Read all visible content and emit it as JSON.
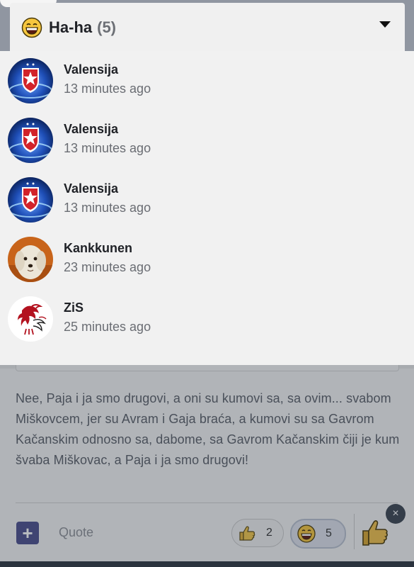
{
  "popup": {
    "reaction_name": "Ha-ha",
    "reaction_count": "(5)",
    "users": [
      {
        "name": "Valensija",
        "time": "13 minutes ago",
        "avatar": "crvena-zvezda-logo"
      },
      {
        "name": "Valensija",
        "time": "13 minutes ago",
        "avatar": "crvena-zvezda-logo"
      },
      {
        "name": "Valensija",
        "time": "13 minutes ago",
        "avatar": "crvena-zvezda-logo"
      },
      {
        "name": "Kankkunen",
        "time": "23 minutes ago",
        "avatar": "white-dog-photo"
      },
      {
        "name": "ZiS",
        "time": "25 minutes ago",
        "avatar": "liverbird-logo"
      }
    ]
  },
  "post": {
    "text": "Nee, Paja i ja smo drugovi, a oni su kumovi sa, sa ovim... svabom Miškovcem, jer su Avram i Gaja braća, a kumovi su sa Gavrom Kačanskim odnosno sa, dabome, sa Gavrom Kačanskim čiji je kum švaba Miškovac, a Paja i ja smo drugovi!"
  },
  "footer": {
    "add_label": "+",
    "quote_label": "Quote",
    "like_count": "2",
    "haha_count": "5",
    "close_label": "×"
  },
  "colors": {
    "accent": "#4c4f8d",
    "overlay": "#262e3c",
    "popup_bg": "#f1f1f1"
  }
}
